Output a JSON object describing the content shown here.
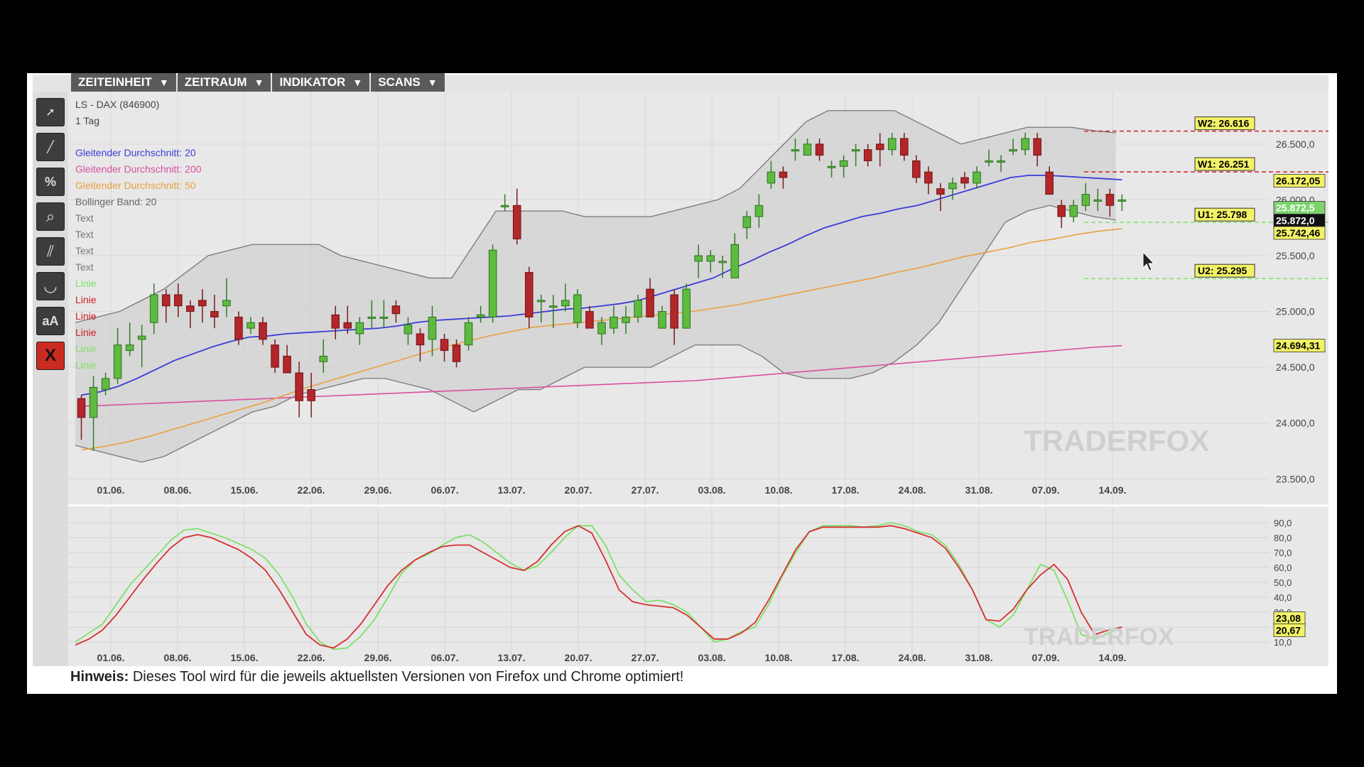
{
  "menu": [
    {
      "label": "ZEITEINHEIT",
      "arrow": "▼"
    },
    {
      "label": "ZEITRAUM",
      "arrow": "▼"
    },
    {
      "label": "INDIKATOR",
      "arrow": "▼"
    },
    {
      "label": "SCANS",
      "arrow": "▼"
    }
  ],
  "tools": [
    {
      "name": "pointer-tool-icon",
      "glyph": "➚"
    },
    {
      "name": "line-tool-icon",
      "glyph": "╱"
    },
    {
      "name": "percent-tool-icon",
      "glyph": "%"
    },
    {
      "name": "zoom-tool-icon",
      "glyph": "⌕"
    },
    {
      "name": "parallel-lines-tool-icon",
      "glyph": "⫽"
    },
    {
      "name": "curve-tool-icon",
      "glyph": "◡"
    },
    {
      "name": "text-tool-icon",
      "glyph": "aA"
    },
    {
      "name": "delete-tool-icon",
      "glyph": "X"
    }
  ],
  "chart": {
    "instrument": "LS - DAX (846900)",
    "timeframe": "1 Tag",
    "watermark": "TRADERFOX",
    "legend": [
      {
        "label": "Gleitender Durchschnitt: 20",
        "color": "#3b3bd6"
      },
      {
        "label": "Gleitender Durchschnitt: 200",
        "color": "#d8509e"
      },
      {
        "label": "Gleitender Durchschnitt: 50",
        "color": "#e8a040"
      },
      {
        "label": "Bollinger Band: 20",
        "color": "#666666"
      },
      {
        "label": "Text",
        "color": "#777777"
      },
      {
        "label": "Text",
        "color": "#777777"
      },
      {
        "label": "Text",
        "color": "#777777"
      },
      {
        "label": "Text",
        "color": "#777777"
      },
      {
        "label": "Linie",
        "color": "#7ee06a"
      },
      {
        "label": "Linie",
        "color": "#cc2222"
      },
      {
        "label": "Linie",
        "color": "#cc2222"
      },
      {
        "label": "Linie",
        "color": "#cc2222"
      },
      {
        "label": "Linie",
        "color": "#7ee06a"
      },
      {
        "label": "Linie",
        "color": "#7ee06a"
      }
    ],
    "x_labels": [
      "01.06.",
      "08.06.",
      "15.06.",
      "22.06.",
      "29.06.",
      "06.07.",
      "13.07.",
      "20.07.",
      "27.07.",
      "03.08.",
      "10.08.",
      "17.08.",
      "24.08.",
      "31.08.",
      "07.09.",
      "14.09."
    ],
    "y_labels": [
      "26.500,0",
      "26.000,0",
      "25.500,0",
      "25.000,0",
      "24.500,0",
      "24.000,0",
      "23.500,0"
    ],
    "osc_y_labels": [
      "90,0",
      "80,0",
      "70,0",
      "60,0",
      "50,0",
      "40,0",
      "30,0",
      "10,0"
    ],
    "levels": [
      {
        "label": "W2: 26.616",
        "value": 26616,
        "color": "#cc2222"
      },
      {
        "label": "W1: 26.251",
        "value": 26251,
        "color": "#cc2222"
      },
      {
        "label": "U1: 25.798",
        "value": 25798,
        "color": "#7ee06a"
      },
      {
        "label": "U2: 25.295",
        "value": 25295,
        "color": "#7ee06a"
      }
    ],
    "price_tags": [
      {
        "text": "26.172,05",
        "value": 26172,
        "bg": "#f2f266",
        "fg": "#000"
      },
      {
        "text": "25.872,5",
        "value": 25872,
        "bg": "#7bd36a",
        "fg": "#fff",
        "row": "a"
      },
      {
        "text": "25.872,0",
        "value": 25872,
        "bg": "#111111",
        "fg": "#fff",
        "row": "b"
      },
      {
        "text": "25.742,46",
        "value": 25742,
        "bg": "#f2f266",
        "fg": "#000"
      },
      {
        "text": "24.694,31",
        "value": 24694,
        "bg": "#f2f266",
        "fg": "#000"
      }
    ],
    "osc_tags": [
      {
        "text": "23,08",
        "value": 23.08,
        "bg": "#f2f266"
      },
      {
        "text": "20,67",
        "value": 20.67,
        "bg": "#f2f266"
      }
    ]
  },
  "chart_data": {
    "type": "candlestick",
    "ylim": [
      23400,
      26900
    ],
    "candles": [
      [
        24220,
        24050,
        24250,
        23850
      ],
      [
        24050,
        24320,
        24420,
        23750
      ],
      [
        24300,
        24400,
        24450,
        24250
      ],
      [
        24400,
        24700,
        24850,
        24350
      ],
      [
        24650,
        24700,
        24900,
        24600
      ],
      [
        24750,
        24780,
        24880,
        24500
      ],
      [
        24900,
        25150,
        25250,
        24800
      ],
      [
        25150,
        25050,
        25200,
        24900
      ],
      [
        25150,
        25050,
        25250,
        24950
      ],
      [
        25050,
        25000,
        25100,
        24850
      ],
      [
        25100,
        25050,
        25200,
        24900
      ],
      [
        25000,
        24950,
        25150,
        24850
      ],
      [
        25050,
        25100,
        25300,
        24950
      ],
      [
        24950,
        24750,
        25000,
        24700
      ],
      [
        24850,
        24900,
        24950,
        24800
      ],
      [
        24900,
        24750,
        24950,
        24700
      ],
      [
        24700,
        24500,
        24750,
        24450
      ],
      [
        24600,
        24450,
        24700,
        24450
      ],
      [
        24450,
        24200,
        24550,
        24050
      ],
      [
        24300,
        24200,
        24450,
        24050
      ],
      [
        24550,
        24600,
        24750,
        24450
      ],
      [
        24970,
        24850,
        25050,
        24750
      ],
      [
        24900,
        24850,
        25050,
        24800
      ],
      [
        24800,
        24900,
        24950,
        24700
      ],
      [
        24950,
        24950,
        25100,
        24850
      ],
      [
        24950,
        24950,
        25100,
        24850
      ],
      [
        25050,
        24980,
        25100,
        24900
      ],
      [
        24800,
        24880,
        24950,
        24700
      ],
      [
        24800,
        24700,
        24850,
        24550
      ],
      [
        24750,
        24950,
        25050,
        24600
      ],
      [
        24750,
        24650,
        24800,
        24550
      ],
      [
        24700,
        24550,
        24750,
        24500
      ],
      [
        24700,
        24900,
        24950,
        24650
      ],
      [
        24950,
        24970,
        25050,
        24900
      ],
      [
        24950,
        25550,
        25600,
        24900
      ],
      [
        25950,
        25950,
        26050,
        25900
      ],
      [
        25950,
        25650,
        26100,
        25600
      ],
      [
        25350,
        24950,
        25400,
        24850
      ],
      [
        25100,
        25100,
        25150,
        24900
      ],
      [
        25050,
        25050,
        25150,
        24850
      ],
      [
        25050,
        25100,
        25250,
        25000
      ],
      [
        24900,
        25150,
        25200,
        24850
      ],
      [
        25000,
        24850,
        25050,
        24850
      ],
      [
        24800,
        24900,
        24950,
        24700
      ],
      [
        24850,
        24950,
        25050,
        24800
      ],
      [
        24900,
        24950,
        25050,
        24800
      ],
      [
        24950,
        25100,
        25150,
        24900
      ],
      [
        25200,
        24950,
        25300,
        24950
      ],
      [
        24850,
        25000,
        25050,
        24850
      ],
      [
        25150,
        24850,
        25200,
        24700
      ],
      [
        24850,
        25200,
        25250,
        24850
      ],
      [
        25450,
        25500,
        25600,
        25300
      ],
      [
        25450,
        25500,
        25550,
        25350
      ],
      [
        25450,
        25450,
        25500,
        25300
      ],
      [
        25300,
        25600,
        25700,
        25300
      ],
      [
        25750,
        25850,
        25900,
        25650
      ],
      [
        25850,
        25950,
        26050,
        25750
      ],
      [
        26150,
        26250,
        26350,
        26100
      ],
      [
        26250,
        26200,
        26300,
        26100
      ],
      [
        26450,
        26450,
        26550,
        26350
      ],
      [
        26400,
        26500,
        26550,
        26400
      ],
      [
        26500,
        26400,
        26550,
        26350
      ],
      [
        26300,
        26300,
        26350,
        26200
      ],
      [
        26300,
        26350,
        26400,
        26200
      ],
      [
        26450,
        26450,
        26500,
        26300
      ],
      [
        26450,
        26350,
        26500,
        26300
      ],
      [
        26500,
        26450,
        26600,
        26300
      ],
      [
        26450,
        26550,
        26600,
        26400
      ],
      [
        26550,
        26400,
        26600,
        26350
      ],
      [
        26350,
        26200,
        26400,
        26150
      ],
      [
        26250,
        26150,
        26300,
        26050
      ],
      [
        26100,
        26050,
        26150,
        25900
      ],
      [
        26100,
        26150,
        26200,
        26000
      ],
      [
        26200,
        26150,
        26250,
        26100
      ],
      [
        26150,
        26250,
        26300,
        26100
      ],
      [
        26350,
        26350,
        26450,
        26300
      ],
      [
        26350,
        26350,
        26400,
        26250
      ],
      [
        26450,
        26450,
        26550,
        26400
      ],
      [
        26450,
        26550,
        26600,
        26400
      ],
      [
        26550,
        26400,
        26600,
        26300
      ],
      [
        26250,
        26050,
        26300,
        26050
      ],
      [
        25950,
        25850,
        26000,
        25750
      ],
      [
        25850,
        25950,
        26000,
        25800
      ],
      [
        25950,
        26050,
        26150,
        25900
      ],
      [
        26000,
        26000,
        26100,
        25900
      ],
      [
        26050,
        25950,
        26100,
        25850
      ],
      [
        26000,
        26000,
        26050,
        25900
      ]
    ],
    "sma20": [
      24250,
      24280,
      24330,
      24400,
      24480,
      24560,
      24620,
      24680,
      24730,
      24770,
      24780,
      24800,
      24810,
      24820,
      24830,
      24840,
      24850,
      24870,
      24900,
      24920,
      24930,
      24940,
      24950,
      24960,
      24980,
      25000,
      25020,
      25030,
      25050,
      25070,
      25100,
      25150,
      25200,
      25250,
      25300,
      25380,
      25450,
      25530,
      25600,
      25680,
      25750,
      25800,
      25850,
      25880,
      25920,
      25950,
      26000,
      26050,
      26100,
      26150,
      26200,
      26220,
      26220,
      26210,
      26200,
      26190,
      26180
    ],
    "sma50": [
      23760,
      23790,
      23830,
      23880,
      23940,
      24000,
      24060,
      24120,
      24180,
      24250,
      24320,
      24380,
      24440,
      24500,
      24560,
      24620,
      24680,
      24730,
      24780,
      24820,
      24860,
      24880,
      24900,
      24920,
      24940,
      24960,
      24980,
      25000,
      25030,
      25060,
      25100,
      25140,
      25180,
      25220,
      25260,
      25300,
      25350,
      25390,
      25440,
      25490,
      25530,
      25570,
      25620,
      25650,
      25690,
      25720,
      25742
    ],
    "sma200": [
      24150,
      24160,
      24170,
      24180,
      24190,
      24200,
      24210,
      24220,
      24230,
      24240,
      24250,
      24260,
      24270,
      24280,
      24290,
      24300,
      24310,
      24320,
      24330,
      24340,
      24350,
      24360,
      24370,
      24380,
      24400,
      24420,
      24440,
      24460,
      24480,
      24500,
      24520,
      24540,
      24560,
      24580,
      24600,
      24620,
      24640,
      24660,
      24680,
      24694
    ],
    "bb_upper": [
      24900,
      24950,
      25000,
      25100,
      25200,
      25350,
      25500,
      25550,
      25600,
      25600,
      25600,
      25600,
      25500,
      25450,
      25400,
      25350,
      25300,
      25300,
      25600,
      25900,
      25900,
      25900,
      25900,
      25850,
      25850,
      25850,
      25850,
      25900,
      25950,
      26000,
      26100,
      26300,
      26500,
      26700,
      26800,
      26800,
      26800,
      26800,
      26700,
      26600,
      26500,
      26550,
      26600,
      26650,
      26650,
      26650,
      26620,
      26600
    ],
    "bb_lower": [
      23800,
      23750,
      23700,
      23650,
      23700,
      23800,
      23900,
      24000,
      24100,
      24150,
      24250,
      24300,
      24350,
      24400,
      24400,
      24350,
      24300,
      24200,
      24100,
      24200,
      24300,
      24300,
      24400,
      24500,
      24500,
      24500,
      24500,
      24600,
      24700,
      24700,
      24700,
      24600,
      24450,
      24400,
      24400,
      24400,
      24450,
      24550,
      24700,
      24900,
      25200,
      25500,
      25800,
      25900,
      25950,
      25900,
      25850,
      25820
    ],
    "stoch_k": [
      10,
      16,
      22,
      35,
      48,
      58,
      68,
      78,
      85,
      86,
      83,
      80,
      76,
      72,
      66,
      55,
      40,
      22,
      10,
      5,
      6,
      14,
      25,
      40,
      56,
      65,
      69,
      75,
      80,
      82,
      77,
      70,
      63,
      58,
      61,
      70,
      80,
      88,
      88,
      75,
      55,
      45,
      37,
      38,
      35,
      30,
      20,
      10,
      12,
      17,
      20,
      35,
      54,
      70,
      84,
      88,
      88,
      88,
      87,
      88,
      90,
      88,
      84,
      82,
      75,
      62,
      45,
      25,
      20,
      28,
      45,
      62,
      58,
      38,
      15,
      12,
      16,
      20
    ],
    "stoch_d": [
      8,
      12,
      18,
      28,
      40,
      52,
      63,
      73,
      80,
      82,
      80,
      76,
      72,
      66,
      58,
      45,
      30,
      15,
      8,
      6,
      12,
      22,
      35,
      48,
      58,
      65,
      70,
      74,
      75,
      75,
      70,
      65,
      60,
      58,
      64,
      75,
      84,
      88,
      83,
      65,
      45,
      37,
      35,
      34,
      33,
      28,
      20,
      12,
      12,
      16,
      23,
      38,
      55,
      72,
      84,
      87,
      87,
      87,
      87,
      87,
      88,
      86,
      83,
      80,
      73,
      60,
      45,
      25,
      24,
      32,
      45,
      55,
      62,
      52,
      30,
      15,
      18,
      20
    ]
  }
}
